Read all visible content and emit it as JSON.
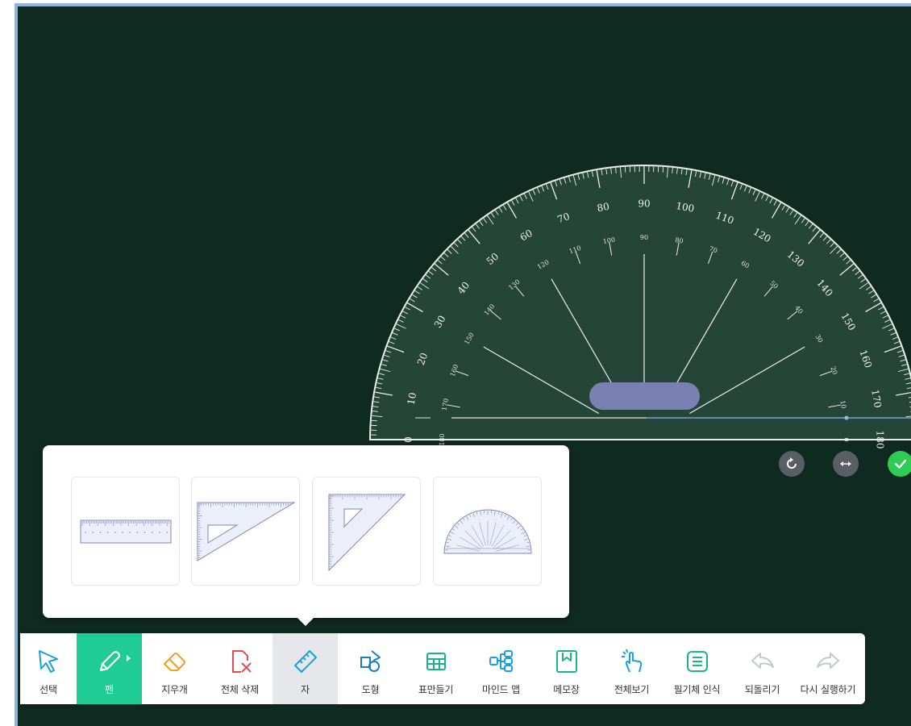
{
  "protractor": {
    "outer_labels": [
      "0",
      "10",
      "20",
      "30",
      "40",
      "50",
      "60",
      "70",
      "80",
      "90",
      "100",
      "110",
      "120",
      "130",
      "140",
      "150",
      "160",
      "170",
      "180"
    ],
    "inner_labels": [
      "180",
      "170",
      "160",
      "150",
      "140",
      "130",
      "120",
      "110",
      "100",
      "90",
      "80",
      "70",
      "60",
      "50",
      "40",
      "30",
      "20",
      "10",
      "0"
    ]
  },
  "protractor_controls": {
    "rotate": "rotate-icon",
    "flip": "flip-horizontal-icon",
    "confirm": "check-icon"
  },
  "ruler_panel": {
    "options": [
      "straight-ruler",
      "triangle-ruler-30-60",
      "triangle-ruler-45",
      "protractor"
    ]
  },
  "toolbar": {
    "items": [
      {
        "label": "선택",
        "icon": "cursor-icon"
      },
      {
        "label": "펜",
        "icon": "pen-icon"
      },
      {
        "label": "지우개",
        "icon": "eraser-icon"
      },
      {
        "label": "전체 삭제",
        "icon": "clear-all-icon"
      },
      {
        "label": "자",
        "icon": "ruler-icon"
      },
      {
        "label": "도형",
        "icon": "shapes-icon"
      },
      {
        "label": "표만들기",
        "icon": "table-icon"
      },
      {
        "label": "마인드 맵",
        "icon": "mind-map-icon"
      },
      {
        "label": "메모장",
        "icon": "memo-icon"
      },
      {
        "label": "전체보기",
        "icon": "view-all-icon"
      },
      {
        "label": "필기체 인식",
        "icon": "handwriting-icon"
      },
      {
        "label": "되돌리기",
        "icon": "undo-icon"
      },
      {
        "label": "다시 실행하기",
        "icon": "redo-icon"
      }
    ]
  },
  "colors": {
    "board_background": "#0f2a20",
    "accent_green": "#1fcc93",
    "icon_teal": "#1bb38a",
    "protractor_handle": "#7b80b3",
    "confirm_green": "#2ecc55"
  }
}
